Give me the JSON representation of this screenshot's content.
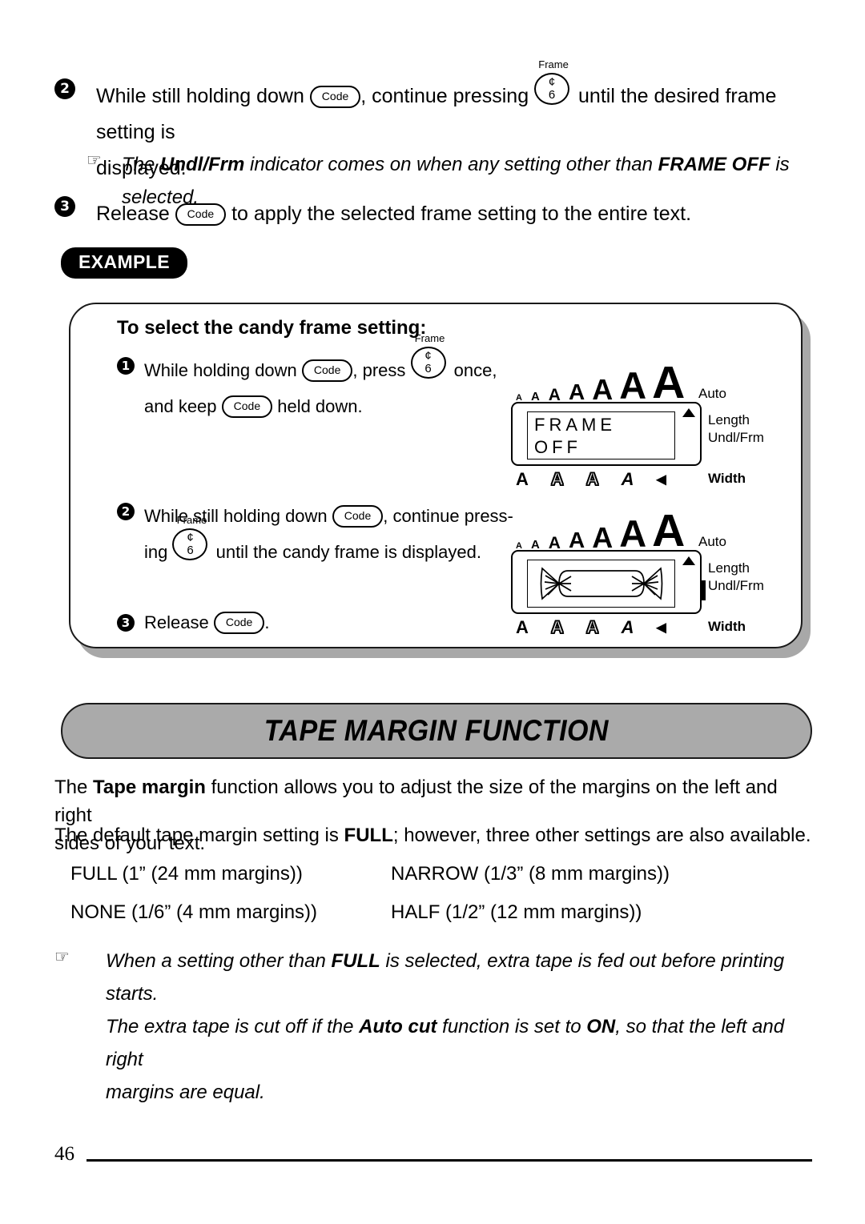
{
  "page": {
    "number": "46"
  },
  "steps_top": [
    {
      "num": "2",
      "text_a": "While still holding down ",
      "key1": "Code",
      "text_b": ", continue pressing ",
      "key2_label": "Frame",
      "key2_top": "¢",
      "key2_bottom": "6",
      "text_c": " until the desired frame setting is",
      "text_d": "displayed."
    },
    {
      "num": "3",
      "text_a": "Release ",
      "key1": "Code",
      "text_b": " to apply the selected frame setting to the entire text."
    }
  ],
  "note_top": {
    "icon": "pointing-hand",
    "seg1": "The ",
    "bold1": "Undl/Frm",
    "seg2": " indicator comes on when any setting other than ",
    "bold2": "FRAME OFF",
    "seg3": " is",
    "line2": "selected."
  },
  "example": {
    "badge": "EXAMPLE",
    "title": "To select the candy frame setting:",
    "steps": [
      {
        "num": "1",
        "text_a": "While  holding  down ",
        "key1": "Code",
        "text_b": ",  press ",
        "key2_label": "Frame",
        "key2_top": "¢",
        "key2_bottom": "6",
        "text_c": "  once,",
        "line2_a": "and keep ",
        "line2_key": "Code",
        "line2_b": " held down."
      },
      {
        "num": "2",
        "text_a": "While still holding down ",
        "key1": "Code",
        "text_b": ", continue press-",
        "line2_a": "ing ",
        "key2_label": "Frame",
        "key2_top": "¢",
        "key2_bottom": "6",
        "line2_b": " until the candy frame is displayed."
      },
      {
        "num": "3",
        "text_a": "Release ",
        "key1": "Code",
        "text_b": "."
      }
    ]
  },
  "lcd": {
    "size_glyphs": [
      "A",
      "A",
      "A",
      "A",
      "A",
      "A",
      "A"
    ],
    "auto_label": "Auto",
    "length_label": "Length",
    "undlfrm_label": "Undl/Frm",
    "width_label": "Width",
    "style_glyphs": [
      "A",
      "A",
      "A",
      "A",
      "◂"
    ],
    "display1": {
      "line1": "FRAME",
      "line2": "OFF"
    },
    "display2": {
      "content": "candy-frame-graphic"
    }
  },
  "section": {
    "banner_title": "TAPE MARGIN FUNCTION"
  },
  "body": {
    "p1_a": "The ",
    "p1_bold": "Tape margin",
    "p1_b": " function allows you to adjust the size of the margins on the left and right",
    "p1_line2": "sides of your text.",
    "p2_a": "The default tape margin setting is ",
    "p2_bold": "FULL",
    "p2_b": "; however, three other settings are also available.",
    "options": [
      "FULL (1” (24 mm margins))",
      "NARROW (1/3” (8 mm margins))",
      "NONE (1/6” (4 mm margins))",
      "HALF (1/2” (12 mm margins))"
    ]
  },
  "note_bottom": {
    "icon": "pointing-hand",
    "seg1": "When a setting other than ",
    "bold1": "FULL",
    "seg2": " is selected, extra tape is fed out before printing starts.",
    "seg3": "The extra tape is cut off if the ",
    "bold2": "Auto cut",
    "seg4": " function is set to ",
    "bold3": "ON",
    "seg5": ", so that the left and right",
    "seg6": "margins are equal."
  },
  "colors": {
    "text": "#000000",
    "banner_fill": "#aaaaaa",
    "shadow": "#a8a8a8",
    "badge_fill": "#000000"
  }
}
